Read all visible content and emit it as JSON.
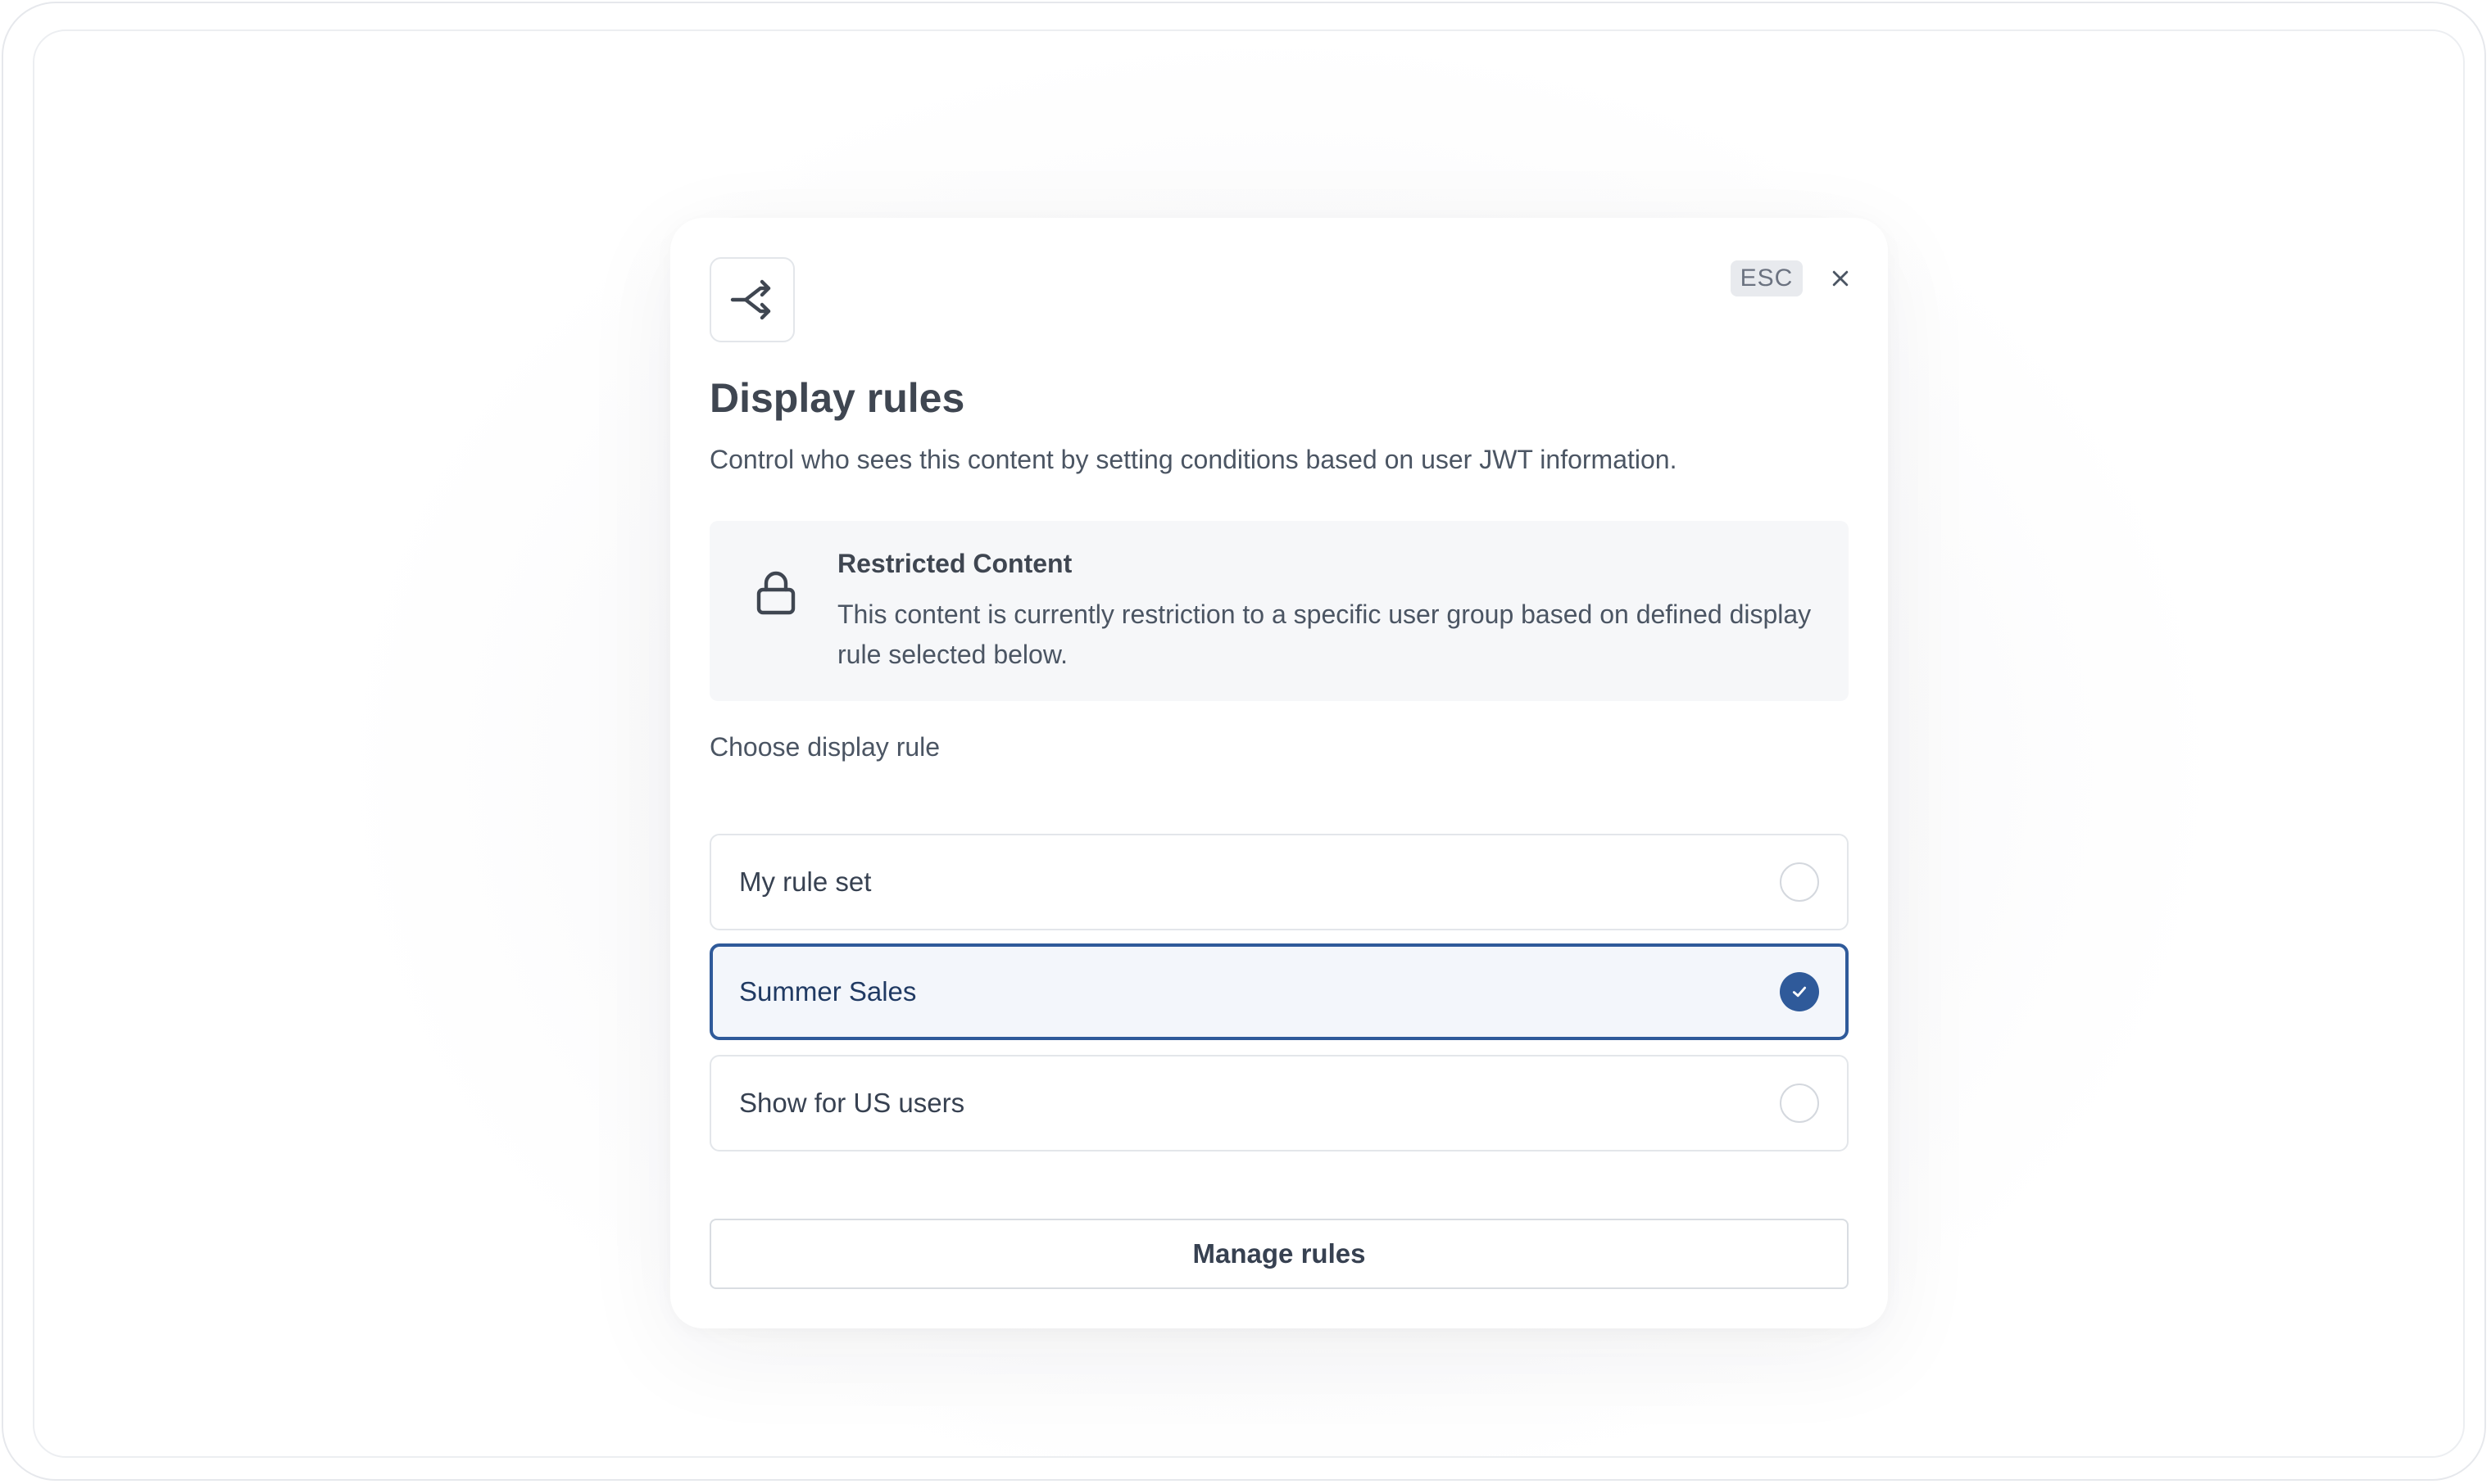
{
  "modal": {
    "esc_label": "ESC",
    "title": "Display rules",
    "subtitle": "Control who sees this content by setting conditions based on user JWT information.",
    "notice": {
      "title": "Restricted Content",
      "body": "This content is currently restriction to a specific user group based on defined display rule selected below."
    },
    "choose_label": "Choose display rule",
    "options": [
      {
        "label": "My rule set",
        "selected": false
      },
      {
        "label": "Summer Sales",
        "selected": true
      },
      {
        "label": "Show for US users",
        "selected": false
      }
    ],
    "manage_label": "Manage rules"
  },
  "colors": {
    "accent": "#2f5a9a",
    "selected_bg": "#f3f6fb",
    "text_primary": "#3f4651",
    "text_secondary": "#4b5563"
  },
  "icons": {
    "header": "split-arrows-icon",
    "notice": "lock-icon",
    "close": "close-icon",
    "selected": "checkmark-icon"
  }
}
